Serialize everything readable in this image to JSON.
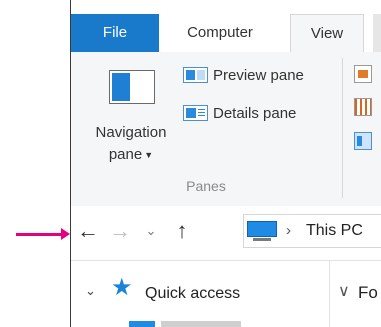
{
  "tabs": {
    "file": "File",
    "computer": "Computer",
    "view": "View"
  },
  "ribbon": {
    "navigation_pane": {
      "label_line1": "Navigation",
      "label_line2": "pane",
      "dropdown_glyph": "▼",
      "icon": "navigation-pane-icon"
    },
    "preview_pane": {
      "label": "Preview pane",
      "icon": "preview-pane-icon"
    },
    "details_pane": {
      "label": "Details pane",
      "icon": "details-pane-icon"
    },
    "group_label": "Panes",
    "layout_icons": [
      "large-icons-icon",
      "small-icons-icon",
      "details-layout-icon"
    ]
  },
  "address_bar": {
    "back_glyph": "←",
    "forward_glyph": "→",
    "recent_glyph": "⌄",
    "up_glyph": "↑",
    "separator_glyph": "›",
    "location_icon": "this-pc-icon",
    "location": "This PC"
  },
  "navigation_pane": {
    "expand_glyph": "⌄",
    "quick_access_icon": "star-icon",
    "quick_access_label": "Quick access",
    "next_item_icon": "desktop-icon"
  },
  "content_pane": {
    "chevron_glyph": "∨",
    "label_fragment": "Fo"
  },
  "annotation": {
    "pointer_color": "#e5007e"
  },
  "colors": {
    "file_tab": "#1979ca",
    "ribbon_bg": "#f5f6f7",
    "accent_blue": "#1f8be4"
  }
}
